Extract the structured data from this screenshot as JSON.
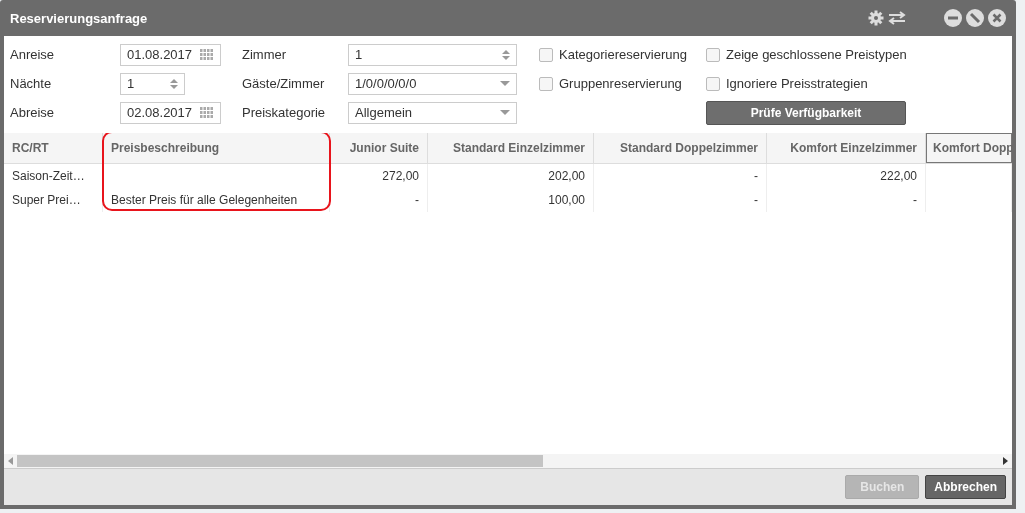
{
  "window": {
    "title": "Reservierungsanfrage"
  },
  "form": [
    {
      "label": "Anreise",
      "value": "01.08.2017",
      "kind": "date"
    },
    {
      "label": "Zimmer",
      "value": "1",
      "kind": "spinner"
    },
    {
      "label": "Nächte",
      "value": "1",
      "kind": "spinner"
    },
    {
      "label": "Gäste/Zimmer",
      "value": "1/0/0/0/0/0",
      "kind": "dropdown"
    },
    {
      "label": "Abreise",
      "value": "02.08.2017",
      "kind": "date"
    },
    {
      "label": "Preiskategorie",
      "value": "Allgemein",
      "kind": "dropdown"
    }
  ],
  "checkboxes": [
    {
      "label": "Kategoriereservierung",
      "checked": false
    },
    {
      "label": "Zeige geschlossene Preistypen",
      "checked": false
    },
    {
      "label": "Gruppenreservierung",
      "checked": false
    },
    {
      "label": "Ignoriere Preisstrategien",
      "checked": false
    }
  ],
  "check_button": "Prüfe Verfügbarkeit",
  "table": {
    "columns": [
      {
        "label": "RC/RT",
        "focused": false,
        "highlighted": false
      },
      {
        "label": "Preisbeschreibung",
        "focused": false,
        "highlighted": true
      },
      {
        "label": "Junior Suite",
        "focused": false,
        "highlighted": false
      },
      {
        "label": "Standard Einzelzimmer",
        "focused": false,
        "highlighted": false
      },
      {
        "label": "Standard Doppelzimmer",
        "focused": false,
        "highlighted": false
      },
      {
        "label": "Komfort Einzelzimmer",
        "focused": false,
        "highlighted": false
      },
      {
        "label": "Komfort Dopp",
        "focused": true,
        "highlighted": false
      }
    ],
    "rows": [
      {
        "cells": [
          "Saison-Zeit…",
          null,
          "272,00",
          "202,00",
          "-",
          "222,00",
          null
        ]
      },
      {
        "cells": [
          "Super Prei…",
          "Bester Preis für alle Gelegenheiten",
          "-",
          "100,00",
          "-",
          "-",
          null
        ]
      }
    ]
  },
  "buttons": [
    {
      "label": "Buchen",
      "disabled": true
    },
    {
      "label": "Abbrechen",
      "disabled": false
    }
  ]
}
